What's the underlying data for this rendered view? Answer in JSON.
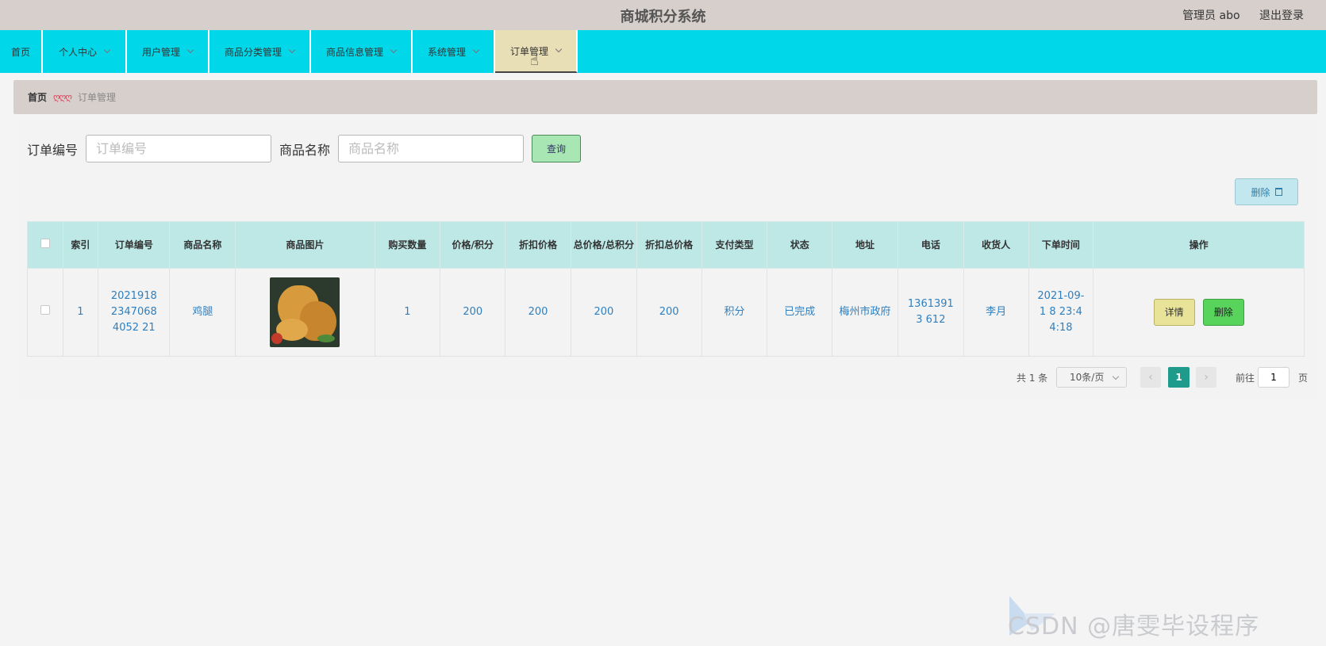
{
  "header": {
    "title": "商城积分系统",
    "user": "管理员 abo",
    "logout": "退出登录"
  },
  "nav": {
    "items": [
      {
        "label": "首页"
      },
      {
        "label": "个人中心"
      },
      {
        "label": "用户管理"
      },
      {
        "label": "商品分类管理"
      },
      {
        "label": "商品信息管理"
      },
      {
        "label": "系统管理"
      },
      {
        "label": "订单管理"
      }
    ],
    "active_index": 6
  },
  "breadcrumb": {
    "home": "首页",
    "separator": "ღღღ",
    "current": "订单管理"
  },
  "search": {
    "order_no_label": "订单编号",
    "order_no_placeholder": "订单编号",
    "product_label": "商品名称",
    "product_placeholder": "商品名称",
    "query_button": "查询"
  },
  "toolbar": {
    "delete_label": "删除"
  },
  "table": {
    "columns": [
      "索引",
      "订单编号",
      "商品名称",
      "商品图片",
      "购买数量",
      "价格/积分",
      "折扣价格",
      "总价格/总积分",
      "折扣总价格",
      "支付类型",
      "状态",
      "地址",
      "电话",
      "收货人",
      "下单时间",
      "操作"
    ],
    "rows": [
      {
        "index": "1",
        "order_no": "202191823470684052 21",
        "product": "鸡腿",
        "quantity": "1",
        "price": "200",
        "discount_price": "200",
        "total": "200",
        "discount_total": "200",
        "pay_type": "积分",
        "status": "已完成",
        "address": "梅州市政府",
        "phone": "13613913 612",
        "receiver": "李月",
        "order_time": "2021-09-1 8 23:44:18",
        "detail_button": "详情",
        "delete_button": "删除"
      }
    ]
  },
  "pagination": {
    "total": "共 1 条",
    "page_size": "10条/页",
    "current_page": "1",
    "goto_label": "前往",
    "goto_value": "1",
    "page_suffix": "页",
    "prev": "‹",
    "next": "›"
  },
  "watermark": "CSDN @唐雯毕设程序"
}
